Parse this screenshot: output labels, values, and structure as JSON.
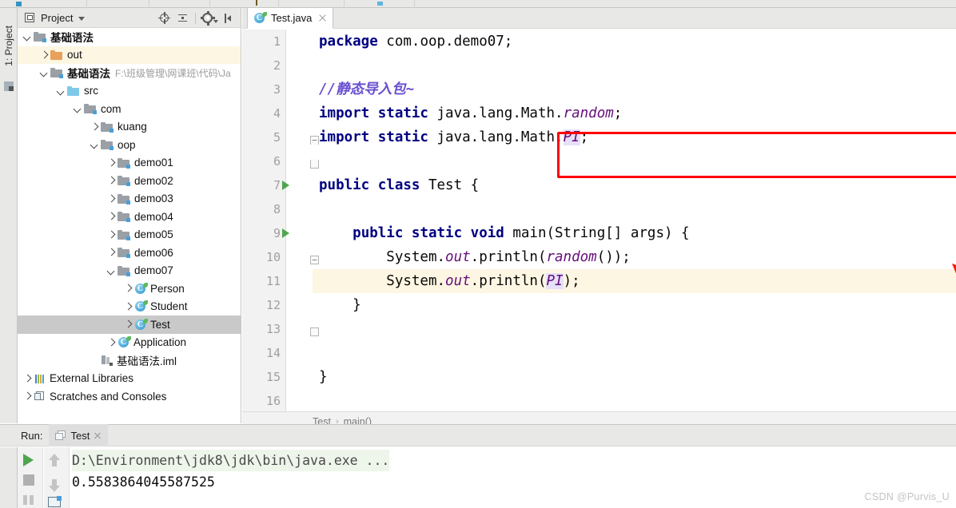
{
  "window": {
    "ide": "IntelliJ IDEA"
  },
  "left_rail": {
    "project_button_label": "1: Project",
    "structure_icon": "structure-icon"
  },
  "project_panel": {
    "title": "Project",
    "title_icon": "project-view-icon",
    "dropdown_icon": "chevron-down-icon",
    "tools": [
      {
        "name": "locate-in-tree-icon",
        "label": "Select Opened File"
      },
      {
        "name": "collapse-all-icon",
        "label": "Collapse All"
      },
      {
        "name": "settings-gear-icon",
        "label": "Settings"
      },
      {
        "name": "hide-panel-icon",
        "label": "Hide"
      }
    ],
    "tree": [
      {
        "label": "基础语法",
        "indent": 0,
        "chevron": "down",
        "icon": "module-folder",
        "bold": true,
        "state": "normal"
      },
      {
        "label": "out",
        "indent": 1,
        "chevron": "right",
        "icon": "excluded-folder",
        "bold": false,
        "state": "highlight"
      },
      {
        "label": "基础语法",
        "indent": 1,
        "chevron": "down",
        "icon": "module-folder",
        "bold": true,
        "state": "normal",
        "path": "F:\\班级管理\\网课班\\代码\\Ja"
      },
      {
        "label": "src",
        "indent": 2,
        "chevron": "down",
        "icon": "source-folder",
        "bold": false,
        "state": "normal"
      },
      {
        "label": "com",
        "indent": 3,
        "chevron": "down",
        "icon": "package-folder",
        "bold": false,
        "state": "normal"
      },
      {
        "label": "kuang",
        "indent": 4,
        "chevron": "right",
        "icon": "package-folder",
        "bold": false,
        "state": "normal"
      },
      {
        "label": "oop",
        "indent": 4,
        "chevron": "down",
        "icon": "package-folder",
        "bold": false,
        "state": "normal"
      },
      {
        "label": "demo01",
        "indent": 5,
        "chevron": "right",
        "icon": "package-folder",
        "bold": false,
        "state": "normal"
      },
      {
        "label": "demo02",
        "indent": 5,
        "chevron": "right",
        "icon": "package-folder",
        "bold": false,
        "state": "normal"
      },
      {
        "label": "demo03",
        "indent": 5,
        "chevron": "right",
        "icon": "package-folder",
        "bold": false,
        "state": "normal"
      },
      {
        "label": "demo04",
        "indent": 5,
        "chevron": "right",
        "icon": "package-folder",
        "bold": false,
        "state": "normal"
      },
      {
        "label": "demo05",
        "indent": 5,
        "chevron": "right",
        "icon": "package-folder",
        "bold": false,
        "state": "normal"
      },
      {
        "label": "demo06",
        "indent": 5,
        "chevron": "right",
        "icon": "package-folder",
        "bold": false,
        "state": "normal"
      },
      {
        "label": "demo07",
        "indent": 5,
        "chevron": "down",
        "icon": "package-folder",
        "bold": false,
        "state": "normal"
      },
      {
        "label": "Person",
        "indent": 6,
        "chevron": "right",
        "icon": "java-class",
        "bold": false,
        "state": "normal"
      },
      {
        "label": "Student",
        "indent": 6,
        "chevron": "right",
        "icon": "java-class",
        "bold": false,
        "state": "normal"
      },
      {
        "label": "Test",
        "indent": 6,
        "chevron": "right",
        "icon": "java-class",
        "bold": false,
        "state": "selected"
      },
      {
        "label": "Application",
        "indent": 5,
        "chevron": "right",
        "icon": "java-class",
        "bold": false,
        "state": "normal"
      },
      {
        "label": "基础语法.iml",
        "indent": 4,
        "chevron": "none",
        "icon": "iml-file",
        "bold": false,
        "state": "normal"
      },
      {
        "label": "External Libraries",
        "indent": 0,
        "chevron": "right",
        "icon": "libraries",
        "bold": false,
        "state": "normal"
      },
      {
        "label": "Scratches and Consoles",
        "indent": 0,
        "chevron": "right",
        "icon": "scratches",
        "bold": false,
        "state": "normal"
      }
    ]
  },
  "editor": {
    "tab": {
      "label": "Test.java",
      "icon": "java-class-icon",
      "close_icon": "close-icon"
    },
    "lines": [
      {
        "n": "1",
        "tokens": [
          {
            "t": "package ",
            "c": "kw"
          },
          {
            "t": "com.oop.demo07;",
            "c": "plain"
          }
        ]
      },
      {
        "n": "2",
        "tokens": []
      },
      {
        "n": "3",
        "tokens": [
          {
            "t": "//静态导入包~",
            "c": "cmt"
          }
        ]
      },
      {
        "n": "4",
        "tokens": [
          {
            "t": "import static ",
            "c": "kw"
          },
          {
            "t": "java.lang.Math.",
            "c": "plain"
          },
          {
            "t": "random",
            "c": "fld"
          },
          {
            "t": ";",
            "c": "plain"
          }
        ]
      },
      {
        "n": "5",
        "tokens": [
          {
            "t": "import static ",
            "c": "kw"
          },
          {
            "t": "java.lang.Math.",
            "c": "plain"
          },
          {
            "t": "PI",
            "c": "fldhl"
          },
          {
            "t": ";",
            "c": "plain"
          }
        ]
      },
      {
        "n": "6",
        "tokens": []
      },
      {
        "n": "7",
        "tokens": [
          {
            "t": "public class ",
            "c": "kw"
          },
          {
            "t": "Test {",
            "c": "plain"
          }
        ]
      },
      {
        "n": "8",
        "tokens": []
      },
      {
        "n": "9",
        "tokens": [
          {
            "t": "    ",
            "c": "plain"
          },
          {
            "t": "public static void ",
            "c": "kw"
          },
          {
            "t": "main(String[] args) {",
            "c": "plain"
          }
        ]
      },
      {
        "n": "10",
        "tokens": [
          {
            "t": "        System.",
            "c": "plain"
          },
          {
            "t": "out",
            "c": "fld"
          },
          {
            "t": ".println(",
            "c": "plain"
          },
          {
            "t": "random",
            "c": "fld"
          },
          {
            "t": "());",
            "c": "plain"
          }
        ]
      },
      {
        "n": "11",
        "tokens": [
          {
            "t": "        System.",
            "c": "plain"
          },
          {
            "t": "out",
            "c": "fld"
          },
          {
            "t": ".println(",
            "c": "plain"
          },
          {
            "t": "PI",
            "c": "fldhl"
          },
          {
            "t": ");",
            "c": "plain"
          }
        ]
      },
      {
        "n": "12",
        "tokens": [
          {
            "t": "    }",
            "c": "plain"
          }
        ]
      },
      {
        "n": "13",
        "tokens": []
      },
      {
        "n": "14",
        "tokens": []
      },
      {
        "n": "15",
        "tokens": [
          {
            "t": "}",
            "c": "plain"
          }
        ]
      },
      {
        "n": "16",
        "tokens": []
      }
    ],
    "caret_line": 11,
    "gutter_run_markers": [
      7,
      9
    ],
    "breadcrumb": {
      "items": [
        "Test",
        "main()"
      ],
      "separator": "›"
    },
    "cursor_icon": "text-ibeam-cursor"
  },
  "annotations": {
    "red_box_label": "highlighted-import-statements",
    "red_arrow_label": "arrow-pointing-to-random-call",
    "color": "#ff0000"
  },
  "run_panel": {
    "run_label": "Run:",
    "tab_label": "Test",
    "tab_icon": "run-configuration-icon",
    "tab_close_icon": "close-icon",
    "buttons": [
      {
        "name": "rerun-button",
        "icon": "play-icon"
      },
      {
        "name": "stop-button",
        "icon": "stop-icon"
      },
      {
        "name": "pause-button",
        "icon": "pause-icon"
      },
      {
        "name": "scroll-up-button",
        "icon": "arrow-up-icon"
      },
      {
        "name": "scroll-down-button",
        "icon": "arrow-down-icon"
      },
      {
        "name": "soft-wrap-button",
        "icon": "soft-wrap-icon"
      }
    ],
    "console": [
      {
        "text": "D:\\Environment\\jdk8\\jdk\\bin\\java.exe ...",
        "type": "command"
      },
      {
        "text": "0.5583864045587525",
        "type": "output"
      }
    ]
  },
  "watermark": {
    "text": "CSDN @Purvis_U"
  }
}
